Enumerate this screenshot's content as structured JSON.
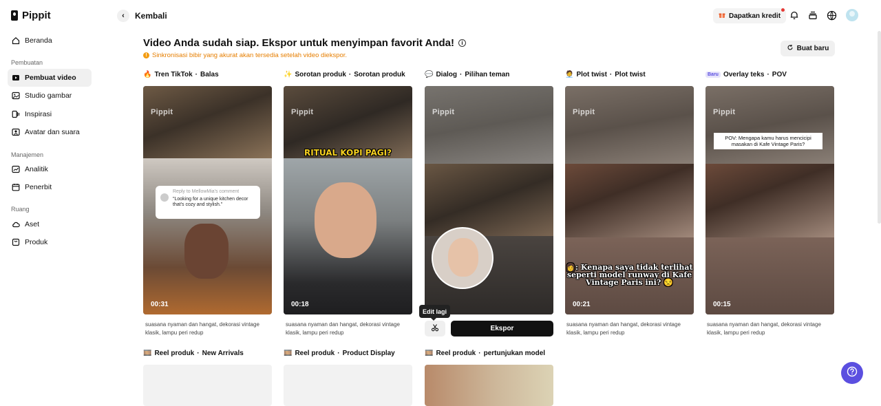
{
  "brand": {
    "name": "Pippit"
  },
  "sidebar": {
    "items": [
      {
        "label": "Beranda"
      },
      {
        "label": "Pembuat video"
      },
      {
        "label": "Studio gambar"
      },
      {
        "label": "Inspirasi"
      },
      {
        "label": "Avatar dan suara"
      },
      {
        "label": "Analitik"
      },
      {
        "label": "Penerbit"
      },
      {
        "label": "Aset"
      },
      {
        "label": "Produk"
      }
    ],
    "sections": {
      "creation": "Pembuatan",
      "management": "Manajemen",
      "space": "Ruang"
    }
  },
  "header": {
    "back_label": "Kembali",
    "credit_label": "Dapatkan kredit",
    "icons": [
      "bell-icon",
      "stack-icon",
      "globe-icon",
      "avatar"
    ]
  },
  "main": {
    "title": "Video Anda sudah siap. Ekspor untuk menyimpan favorit Anda!",
    "note": "Sinkronisasi bibir yang akurat akan tersedia setelah video diekspor.",
    "new_button": "Buat baru",
    "watermark": "Pippit",
    "cards": [
      {
        "emoji": "🔥",
        "title": "Tren TikTok",
        "sub": "Balas",
        "duration": "00:31",
        "desc": "suasana nyaman dan hangat, dekorasi vintage klasik, lampu peri redup",
        "reply_to": "Reply to MellowMia's comment",
        "reply_text": "\"Looking for a unique kitchen decor that's cozy and stylish.\""
      },
      {
        "emoji": "✨",
        "title": "Sorotan produk",
        "sub": "Sorotan produk",
        "duration": "00:18",
        "desc": "suasana nyaman dan hangat, dekorasi vintage klasik, lampu peri redup",
        "overlay": "RITUAL KOPI PAGI?"
      },
      {
        "emoji": "💬",
        "title": "Dialog",
        "sub": "Pilihan teman"
      },
      {
        "emoji": "🧑‍💼",
        "title": "Plot twist",
        "sub": "Plot twist",
        "duration": "00:21",
        "desc": "suasana nyaman dan hangat, dekorasi vintage klasik, lampu peri redup",
        "overlay": "👩: Kenapa saya tidak terlihat seperti model runway di Kafe Vintage Paris ini? 😒"
      },
      {
        "badge": "Baru",
        "title": "Overlay teks",
        "sub": "POV",
        "duration": "00:15",
        "desc": "suasana nyaman dan hangat, dekorasi vintage klasik, lampu peri redup",
        "overlay": "POV: Mengapa kamu harus mencicipi masakan di Kafe Vintage Paris?"
      }
    ],
    "edit_tooltip": "Edit lagi",
    "export_button": "Ekspor",
    "row2": [
      {
        "emoji": "🎞️",
        "title": "Reel produk",
        "sub": "New Arrivals"
      },
      {
        "emoji": "🎞️",
        "title": "Reel produk",
        "sub": "Product Display"
      },
      {
        "emoji": "🎞️",
        "title": "Reel produk",
        "sub": "pertunjukan model"
      }
    ]
  },
  "colors": {
    "accent": "#5b4fe0",
    "warning": "#e67e00",
    "primary_button": "#111111"
  }
}
